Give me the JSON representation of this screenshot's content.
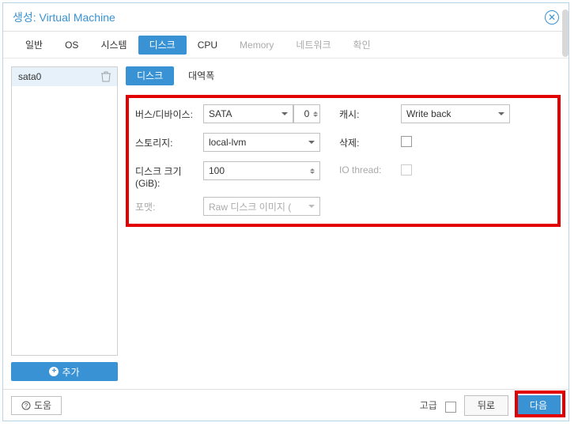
{
  "header": {
    "title": "생성: Virtual Machine"
  },
  "tabs": [
    {
      "label": "일반",
      "active": false,
      "disabled": false
    },
    {
      "label": "OS",
      "active": false,
      "disabled": false
    },
    {
      "label": "시스템",
      "active": false,
      "disabled": false
    },
    {
      "label": "디스크",
      "active": true,
      "disabled": false
    },
    {
      "label": "CPU",
      "active": false,
      "disabled": false
    },
    {
      "label": "Memory",
      "active": false,
      "disabled": true
    },
    {
      "label": "네트워크",
      "active": false,
      "disabled": true
    },
    {
      "label": "확인",
      "active": false,
      "disabled": true
    }
  ],
  "sidebar": {
    "disks": [
      "sata0"
    ],
    "add_label": "추가"
  },
  "subtabs": [
    {
      "label": "디스크",
      "active": true
    },
    {
      "label": "대역폭",
      "active": false
    }
  ],
  "form": {
    "bus_label": "버스/디바이스:",
    "bus_value": "SATA",
    "bus_index": "0",
    "storage_label": "스토리지:",
    "storage_value": "local-lvm",
    "size_label": "디스크 크기 (GiB):",
    "size_value": "100",
    "format_label": "포맷:",
    "format_value": "Raw 디스크 이미지 (",
    "cache_label": "캐시:",
    "cache_value": "Write back",
    "discard_label": "삭제:",
    "iothread_label": "IO thread:"
  },
  "footer": {
    "help": "도움",
    "advanced": "고급",
    "back": "뒤로",
    "next": "다음"
  }
}
